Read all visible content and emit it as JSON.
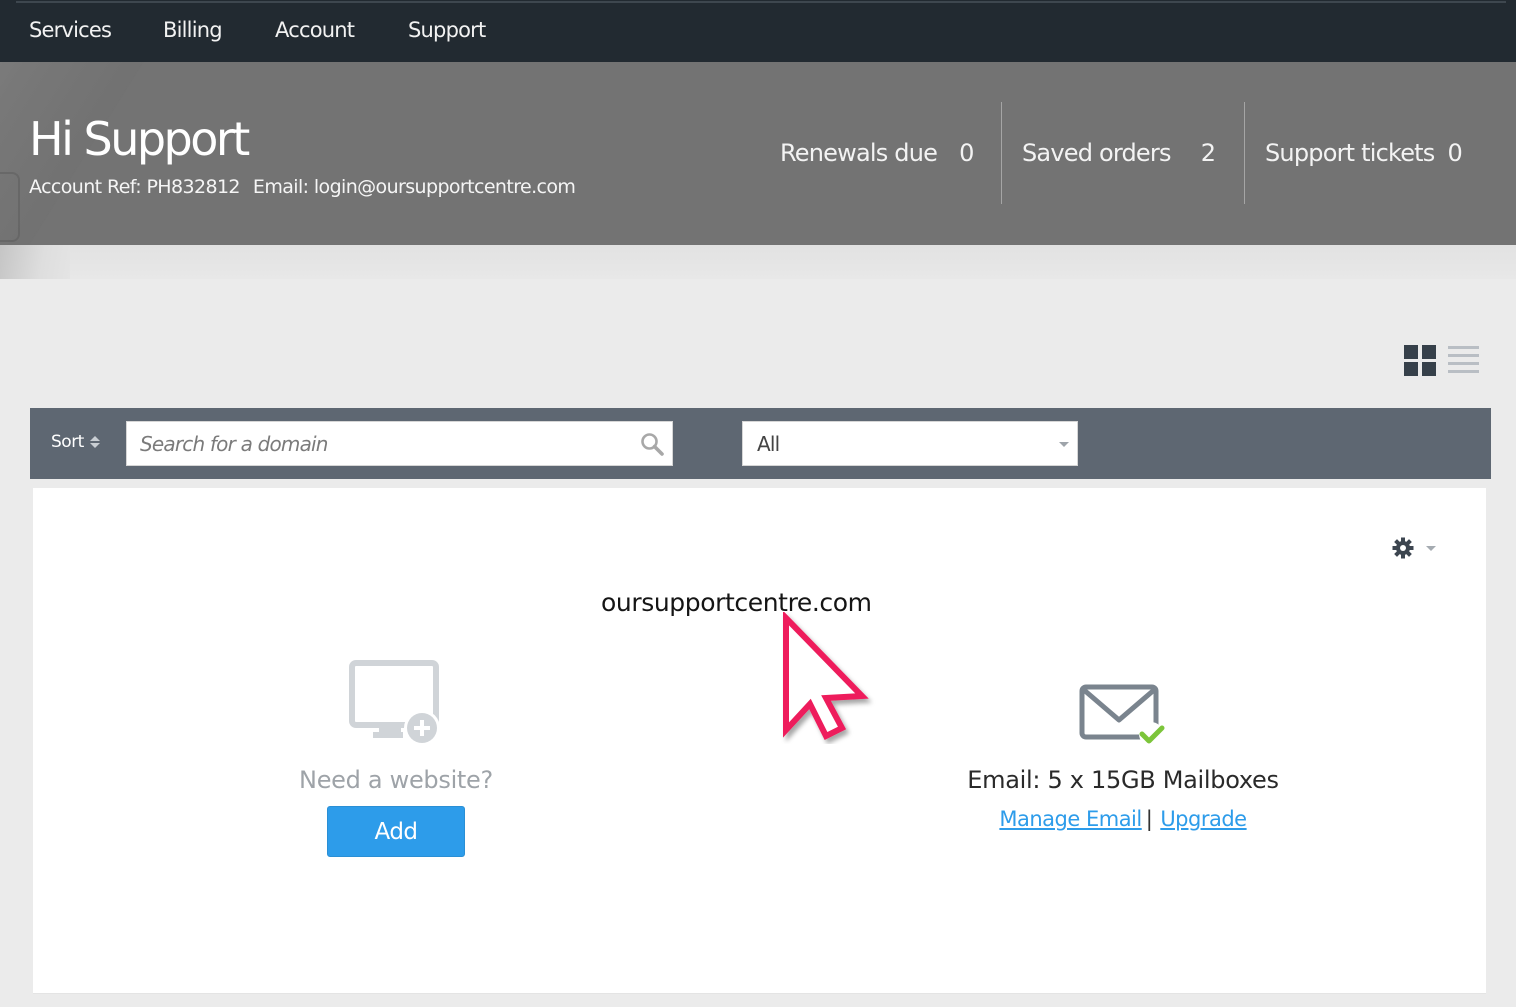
{
  "nav": {
    "items": [
      {
        "label": "Services"
      },
      {
        "label": "Billing"
      },
      {
        "label": "Account"
      },
      {
        "label": "Support"
      }
    ]
  },
  "banner": {
    "greeting": "Hi Support",
    "account_ref": "Account Ref: PH832812",
    "email": "Email: login@oursupportcentre.com",
    "stats": [
      {
        "label": "Renewals due",
        "value": "0"
      },
      {
        "label": "Saved orders",
        "value": "2"
      },
      {
        "label": "Support tickets",
        "value": "0"
      }
    ]
  },
  "view_toggle": {
    "grid_icon": "grid-view-icon",
    "list_icon": "list-view-icon",
    "active": "grid"
  },
  "filter_bar": {
    "sort_label": "Sort",
    "search_placeholder": "Search for a domain",
    "search_value": "",
    "search_icon": "magnifier-icon",
    "filter_selected": "All"
  },
  "domain_card": {
    "domain": "oursupportcentre.com",
    "settings_icon": "gear-icon",
    "website": {
      "icon": "monitor-plus-icon",
      "prompt": "Need a website?",
      "button_label": "Add"
    },
    "email": {
      "icon": "envelope-check-icon",
      "description": "Email: 5 x 15GB Mailboxes",
      "manage_link": "Manage Email",
      "separator": "|",
      "upgrade_link": "Upgrade"
    }
  },
  "colors": {
    "nav_bg": "#222a31",
    "banner_bg": "#737373",
    "filter_bar_bg": "#5e6772",
    "accent": "#2d9cea",
    "success": "#7cc53a",
    "cursor": "#ee1c5b"
  }
}
